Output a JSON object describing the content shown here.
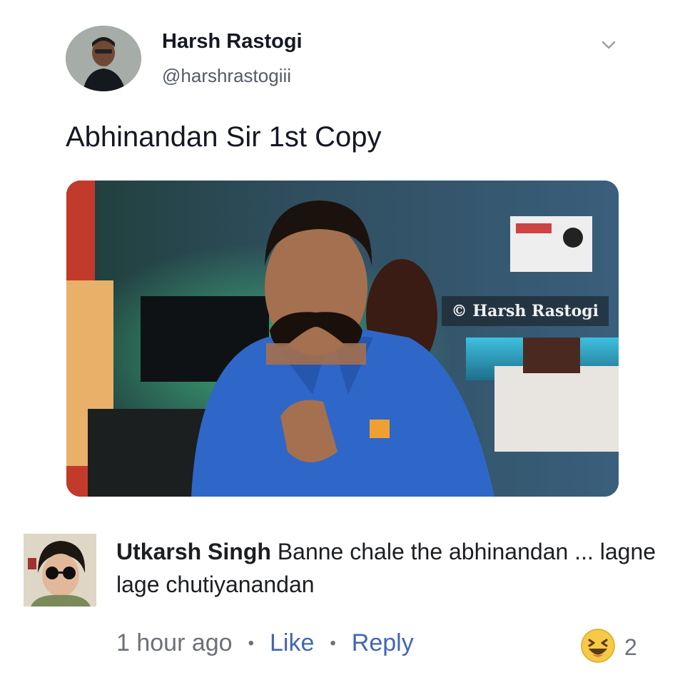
{
  "tweet": {
    "author_name": "Harsh Rastogi",
    "author_handle": "@harshrastogiii",
    "text": "Abhinandan Sir 1st Copy",
    "menu_icon": "chevron-down-icon"
  },
  "media": {
    "watermark": "© Harsh Rastogi"
  },
  "comment": {
    "author": "Utkarsh Singh",
    "text": "Banne chale the abhinandan ... lagne lage chutiyanandan",
    "time": "1 hour ago",
    "like_label": "Like",
    "reply_label": "Reply",
    "reaction_icon": "laughing-emoji-icon",
    "reaction_count": "2"
  },
  "colors": {
    "link": "#4267b2",
    "meta": "#6b7079",
    "shirt": "#2f67c8"
  }
}
